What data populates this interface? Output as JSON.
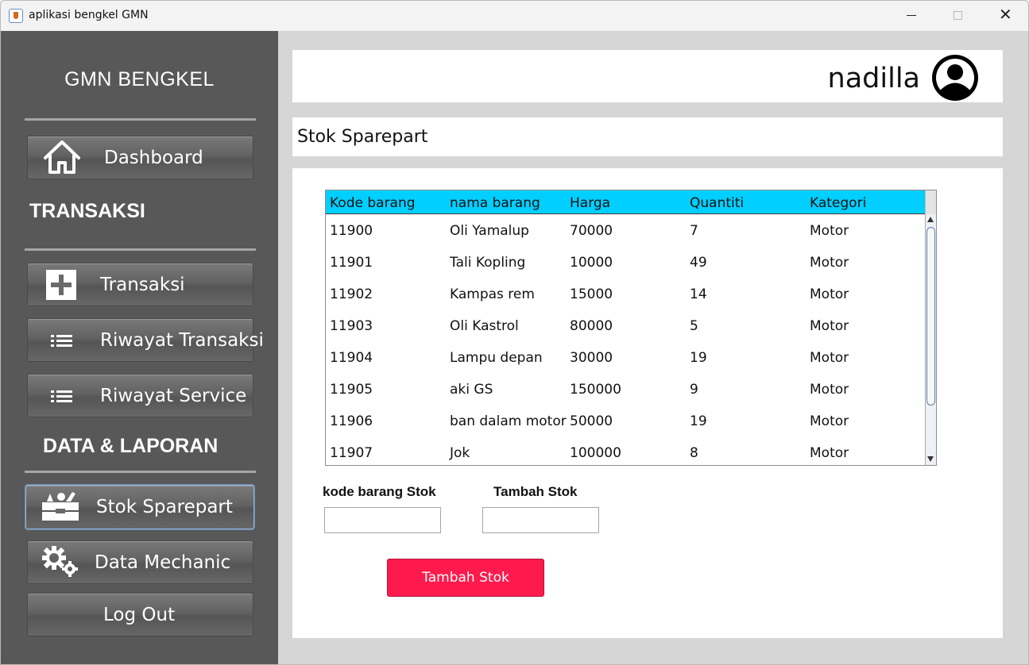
{
  "window": {
    "title": "aplikasi bengkel GMN",
    "close_glyph": "✕"
  },
  "sidebar": {
    "brand": "GMN BENGKEL",
    "dashboard_label": "Dashboard",
    "section_transaksi": "TRANSAKSI",
    "section_laporan": "DATA & LAPORAN",
    "items": [
      {
        "label": "Transaksi",
        "icon": "plus-icon"
      },
      {
        "label": "Riwayat Transaksi",
        "icon": "list-icon"
      },
      {
        "label": "Riwayat Service",
        "icon": "list-icon"
      }
    ],
    "data_items": [
      {
        "label": "Stok Sparepart",
        "icon": "toolbox-icon",
        "active": true
      },
      {
        "label": "Data Mechanic",
        "icon": "gears-icon"
      },
      {
        "label": "Log Out",
        "icon": ""
      }
    ]
  },
  "header": {
    "username": "nadilla",
    "avatar_icon": "user-avatar-icon"
  },
  "page": {
    "title": "Stok Sparepart"
  },
  "table": {
    "header_color": "#00cfff",
    "columns": [
      "Kode barang",
      "nama barang",
      "Harga",
      "Quantiti",
      "Kategori"
    ],
    "rows": [
      [
        "11900",
        "Oli Yamalup",
        "70000",
        "7",
        "Motor"
      ],
      [
        "11901",
        "Tali Kopling",
        "10000",
        "49",
        "Motor"
      ],
      [
        "11902",
        "Kampas rem",
        "15000",
        "14",
        "Motor"
      ],
      [
        "11903",
        "Oli Kastrol",
        "80000",
        "5",
        "Motor"
      ],
      [
        "11904",
        "Lampu depan",
        "30000",
        "19",
        "Motor"
      ],
      [
        "11905",
        "aki GS",
        "150000",
        "9",
        "Motor"
      ],
      [
        "11906",
        "ban dalam motor",
        "50000",
        "19",
        "Motor"
      ],
      [
        "11907",
        "Jok",
        "100000",
        "8",
        "Motor"
      ]
    ]
  },
  "form": {
    "kode_label": "kode barang Stok",
    "kode_value": "",
    "tambah_label": "Tambah Stok",
    "tambah_value": "",
    "submit_label": "Tambah Stok",
    "submit_color": "#ff1a4d"
  }
}
